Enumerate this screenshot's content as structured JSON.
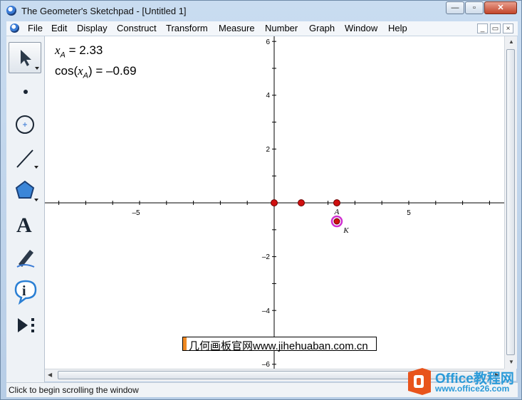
{
  "window": {
    "title": "The Geometer's Sketchpad - [Untitled 1]",
    "controls": {
      "minimize": "—",
      "maximize": "▫",
      "close": "✕"
    }
  },
  "menubar": {
    "items": [
      "File",
      "Edit",
      "Display",
      "Construct",
      "Transform",
      "Measure",
      "Number",
      "Graph",
      "Window",
      "Help"
    ],
    "doc_controls": {
      "minimize": "_",
      "restore": "▭",
      "close": "×"
    }
  },
  "toolbox": {
    "tools": [
      "selection-arrow-tool",
      "point-tool",
      "compass-tool",
      "straightedge-tool",
      "polygon-tool",
      "text-tool",
      "marker-tool",
      "information-tool",
      "custom-tool"
    ],
    "selected": "selection-arrow-tool",
    "text_tool_glyph": "A",
    "info_tool_glyph": "i"
  },
  "measurements": {
    "xa_var": "x",
    "xa_sub": "A",
    "xa_value": "= 2.33",
    "cos_prefix": "cos(",
    "cos_var": "x",
    "cos_sub": "A",
    "cos_suffix": ") = –0.69"
  },
  "graph": {
    "x_tick_labels": [
      "–5",
      "5"
    ],
    "y_tick_labels": [
      "6",
      "4",
      "2",
      "–2",
      "–4",
      "–6"
    ],
    "point_labels": {
      "A": "A",
      "K": "K"
    },
    "point_color": "#d01010",
    "highlight_color": "#d030d0"
  },
  "watermark": {
    "text": "几何画板官网www.jihehuaban.com.cn"
  },
  "logo": {
    "title": "Office教程网",
    "subtitle": "www.office26.com"
  },
  "status": {
    "text": "Click to begin scrolling the window"
  }
}
